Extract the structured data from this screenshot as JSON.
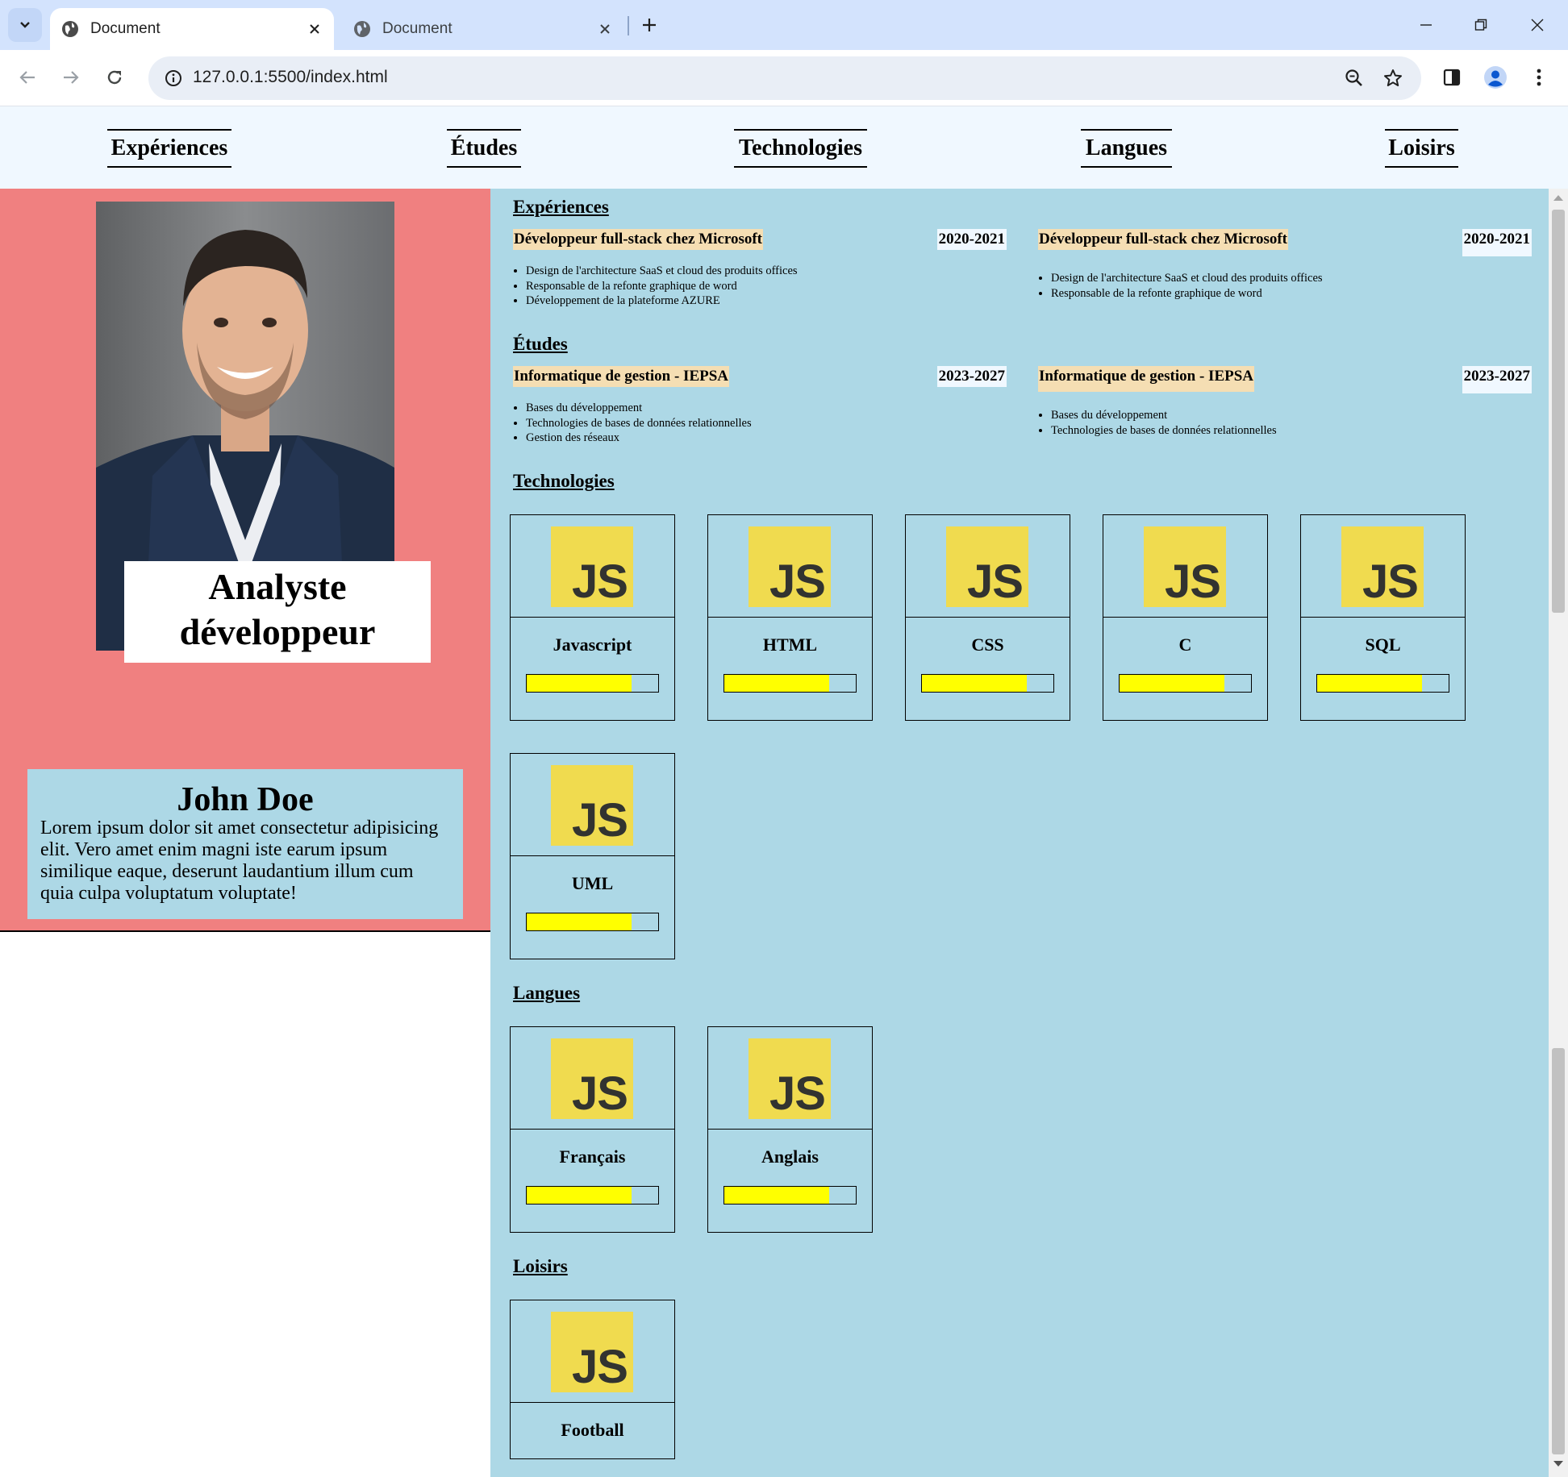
{
  "browser": {
    "tabs": [
      {
        "title": "Document",
        "active": true
      },
      {
        "title": "Document",
        "active": false
      }
    ],
    "url": "127.0.0.1:5500/index.html"
  },
  "nav": [
    "Expériences",
    "Études",
    "Technologies",
    "Langues",
    "Loisirs"
  ],
  "profile": {
    "job_title": "Analyste développeur",
    "name": "John Doe",
    "bio": "Lorem ipsum dolor sit amet consectetur adipisicing elit. Vero amet enim magni iste earum ipsum similique eaque, deserunt laudantium illum cum quia culpa voluptatum voluptate!"
  },
  "experiences": {
    "title": "Expériences",
    "items": [
      {
        "name": "Développeur full-stack chez Microsoft",
        "years": "2020-2021",
        "points": [
          "Design de l'architecture SaaS et cloud des produits offices",
          "Responsable de la refonte graphique de word",
          "Développement de la plateforme AZURE"
        ]
      },
      {
        "name": "Développeur full-stack chez Microsoft",
        "years": "2020-2021",
        "points": [
          "Design de l'architecture SaaS et cloud des produits offices",
          "Responsable de la refonte graphique de word"
        ]
      }
    ]
  },
  "studies": {
    "title": "Études",
    "items": [
      {
        "name": "Informatique de gestion - IEPSA",
        "years": "2023-2027",
        "points": [
          "Bases du développement",
          "Technologies de bases de données relationnelles",
          "Gestion des réseaux"
        ]
      },
      {
        "name": "Informatique de gestion - IEPSA",
        "years": "2023-2027",
        "points": [
          "Bases du développement",
          "Technologies de bases de données relationnelles"
        ]
      }
    ]
  },
  "technologies": {
    "title": "Technologies",
    "items": [
      {
        "label": "Javascript",
        "level": 0.8,
        "logo_text": "JS"
      },
      {
        "label": "HTML",
        "level": 0.8,
        "logo_text": "JS"
      },
      {
        "label": "CSS",
        "level": 0.8,
        "logo_text": "JS"
      },
      {
        "label": "C",
        "level": 0.8,
        "logo_text": "JS"
      },
      {
        "label": "SQL",
        "level": 0.8,
        "logo_text": "JS"
      },
      {
        "label": "UML",
        "level": 0.8,
        "logo_text": "JS"
      }
    ]
  },
  "languages": {
    "title": "Langues",
    "items": [
      {
        "label": "Français",
        "level": 0.8,
        "logo_text": "JS"
      },
      {
        "label": "Anglais",
        "level": 0.8,
        "logo_text": "JS"
      }
    ]
  },
  "hobbies": {
    "title": "Loisirs",
    "items": [
      {
        "label": "Football",
        "logo_text": "JS"
      }
    ]
  },
  "colors": {
    "left_pane": "#f08080",
    "main_pane": "#add8e6",
    "nav_bg": "#f0f8ff",
    "entry_highlight": "#f5deb3",
    "skill_fill": "#ffff00",
    "js_logo": "#f0db4f"
  },
  "icons": [
    "tab-search-icon",
    "globe-icon",
    "close-icon",
    "new-tab-icon",
    "minimize-icon",
    "restore-icon",
    "back-icon",
    "forward-icon",
    "reload-icon",
    "site-info-icon",
    "zoom-icon",
    "bookmark-star-icon",
    "side-panel-icon",
    "profile-icon",
    "menu-icon",
    "js-logo-icon"
  ]
}
